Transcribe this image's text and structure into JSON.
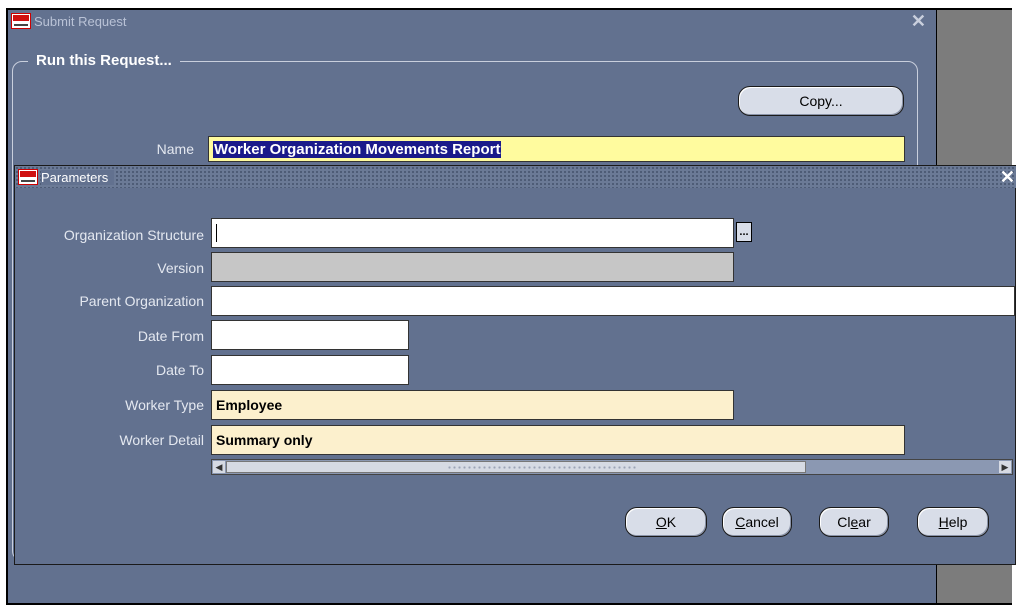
{
  "outer_window": {
    "title": "Submit Request",
    "group_label": "Run this Request...",
    "copy_button": "Copy...",
    "name_label": "Name",
    "name_value": "Worker Organization Movements Report"
  },
  "parameters_window": {
    "title": "Parameters",
    "fields": [
      {
        "label": "Organization Structure",
        "value": ""
      },
      {
        "label": "Version",
        "value": ""
      },
      {
        "label": "Parent Organization",
        "value": ""
      },
      {
        "label": "Date From",
        "value": ""
      },
      {
        "label": "Date To",
        "value": ""
      },
      {
        "label": "Worker Type",
        "value": "Employee"
      },
      {
        "label": "Worker Detail",
        "value": "Summary only"
      }
    ],
    "lov_button": "...",
    "buttons": {
      "ok": {
        "mnemonic": "O",
        "rest": "K"
      },
      "cancel": {
        "mnemonic": "C",
        "rest": "ancel"
      },
      "clear": {
        "pre": "Cl",
        "mnemonic": "e",
        "rest": "ar"
      },
      "help": {
        "mnemonic": "H",
        "rest": "elp"
      }
    }
  },
  "colors": {
    "window_bg": "#62718f",
    "required_field": "#fcf0cd",
    "name_field": "#fffb9e",
    "disabled_field": "#c6c6c6"
  },
  "icons": [
    "oracle-app-icon",
    "close-icon",
    "lov-icon",
    "scroll-left-icon",
    "scroll-right-icon"
  ]
}
